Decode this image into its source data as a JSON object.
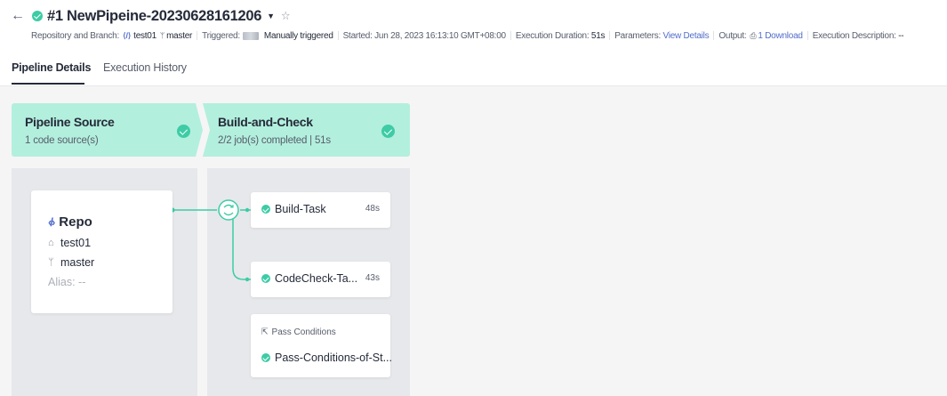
{
  "header": {
    "title": "#1 NewPipeine-20230628161206"
  },
  "meta": {
    "repo_label": "Repository and Branch:",
    "repo_value": "test01",
    "branch_value": "master",
    "triggered_label": "Triggered:",
    "triggered_value": "Manually triggered",
    "started": "Started: Jun 28, 2023 16:13:10 GMT+08:00",
    "duration_label": "Execution Duration:",
    "duration_value": "51s",
    "params_label": "Parameters:",
    "params_link": "View Details",
    "output_label": "Output:",
    "output_link": "1 Download",
    "desc_label": "Execution Description:",
    "desc_value": "--"
  },
  "tabs": [
    {
      "label": "Pipeline Details",
      "active": true
    },
    {
      "label": "Execution History",
      "active": false
    }
  ],
  "stages": [
    {
      "title": "Pipeline Source",
      "subtitle": "1 code source(s)",
      "status": "success"
    },
    {
      "title": "Build-and-Check",
      "subtitle": "2/2 job(s) completed  | 51s",
      "status": "success"
    }
  ],
  "source": {
    "name": "Repo",
    "repo": "test01",
    "branch": "master",
    "alias": "Alias: --"
  },
  "jobs": [
    {
      "name": "Build-Task",
      "duration": "48s",
      "status": "success"
    },
    {
      "name": "CodeCheck-Ta...",
      "duration": "43s",
      "status": "success"
    }
  ],
  "pass_conditions": {
    "label": "Pass Conditions",
    "item": "Pass-Conditions-of-St..."
  },
  "colors": {
    "success": "#3dcca6",
    "stage_header": "#b3efdd",
    "link": "#526ecc",
    "connector": "#3dcca6"
  },
  "icons": {
    "back": "back-arrow-icon",
    "status": "success-check-icon",
    "dropdown": "caret-down-icon",
    "favorite": "star-icon",
    "repo": "repo-icon",
    "branch": "branch-icon",
    "output": "download-icon",
    "parallel": "parallel-icon",
    "pass": "pass-condition-icon"
  }
}
